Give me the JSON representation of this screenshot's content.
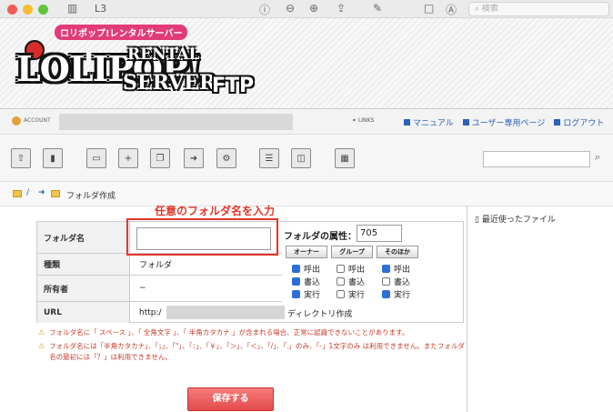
{
  "window": {
    "title": "L3",
    "search_placeholder": "検索"
  },
  "banner": {
    "logo_sub": "ロリポップ!レンタルサーバー",
    "logo_main": "LOLIPOP!",
    "logo_rental": "RENTAL",
    "logo_server": "SERVER",
    "logo_ftp": "FTP"
  },
  "account": {
    "user_label": "ACCOUNT",
    "link_badge": "LINKS",
    "links": [
      "マニュアル",
      "ユーザー専用ページ",
      "ログアウト"
    ]
  },
  "breadcrumb": {
    "current": "フォルダ作成"
  },
  "annotation": "任意のフォルダ名を入力",
  "form": {
    "labels": {
      "name": "フォルダ名",
      "type": "種類",
      "owner": "所有者",
      "url": "URL"
    },
    "type_value": "フォルダ",
    "owner_value": "~",
    "url_prefix": "http:/",
    "url_suffix": "ディレクトリ作成",
    "attr_label": "フォルダの属性：",
    "attr_value": "705",
    "groups": [
      "オーナー",
      "グループ",
      "そのほか"
    ],
    "perm_labels": [
      "呼出",
      "書込",
      "実行"
    ],
    "permissions": [
      [
        true,
        true,
        true
      ],
      [
        false,
        false,
        false
      ],
      [
        true,
        false,
        true
      ]
    ]
  },
  "notes": [
    "フォルダ名に「 スペース 」、「 全角文字 」、「 半角カタカナ 」が含まれる場合、正常に認識できないことがあります。",
    "フォルダ名には「半角カタカナ」、「；」、「\"」、「：」、「￥」、「＞」、「＜」、「/」、「.」のみ、「-」1文字のみ は利用できません。またフォルダ名の最初には「？」は利用できません。"
  ],
  "right_panel": {
    "recent_label": "最近使ったファイル"
  },
  "save_button": "保存する",
  "colors": {
    "accent_red": "#e2372a",
    "link_blue": "#2a62b8",
    "save_button": "#e24b4b"
  }
}
